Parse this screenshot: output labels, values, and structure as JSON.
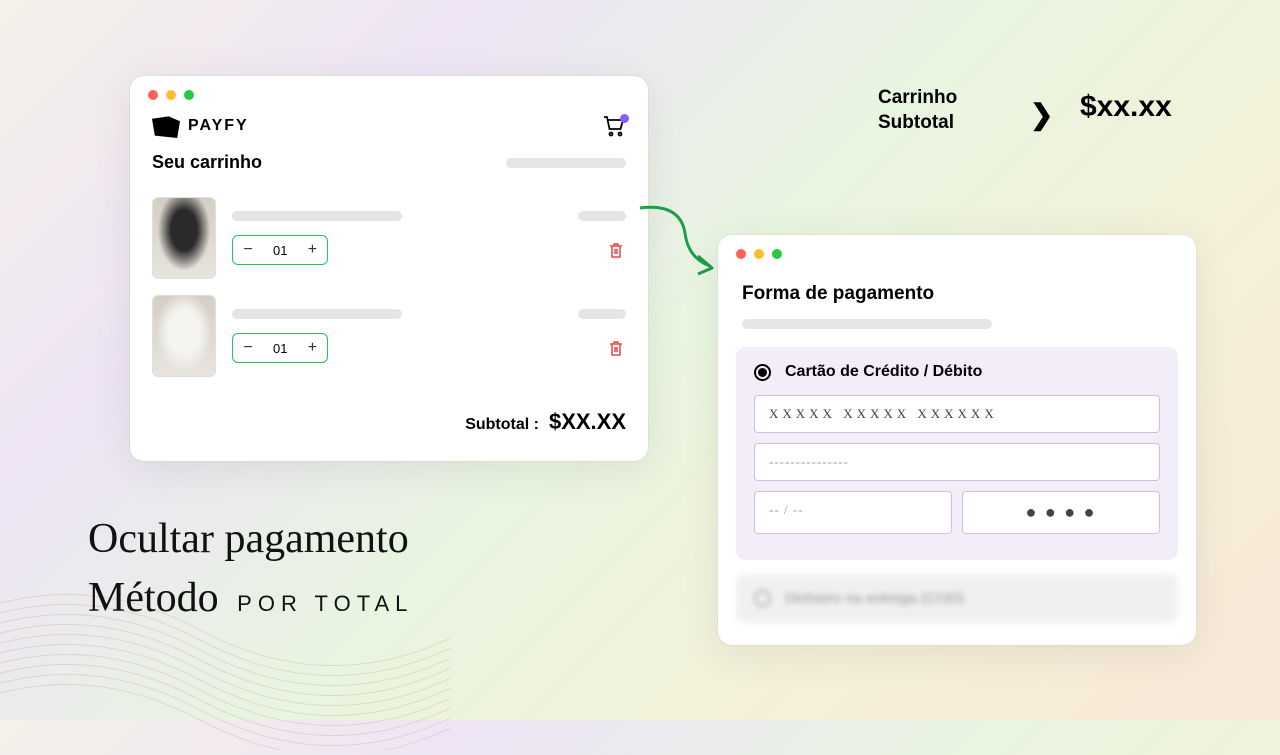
{
  "brand": {
    "name": "PAYFY"
  },
  "cart": {
    "title": "Seu carrinho",
    "items": [
      {
        "qty": "01"
      },
      {
        "qty": "01"
      }
    ],
    "subtotal_label": "Subtotal :",
    "subtotal_value": "$XX.XX"
  },
  "payment": {
    "title": "Forma de pagamento",
    "credit_label": "Cartão de Crédito / Débito",
    "card_placeholder": "XXXXX XXXXX XXXXXX",
    "name_placeholder": "---------------",
    "expiry_placeholder": "-- / --",
    "cvv_placeholder": "● ● ● ●",
    "hidden_label": "Dinheiro na entrega (COD)"
  },
  "compare": {
    "line1": "Carrinho",
    "line2": "Subtotal",
    "op": "❯",
    "value": "$xx.xx"
  },
  "headline": {
    "line1": "Ocultar pagamento",
    "line2a": "Método",
    "line2b": "por total"
  }
}
